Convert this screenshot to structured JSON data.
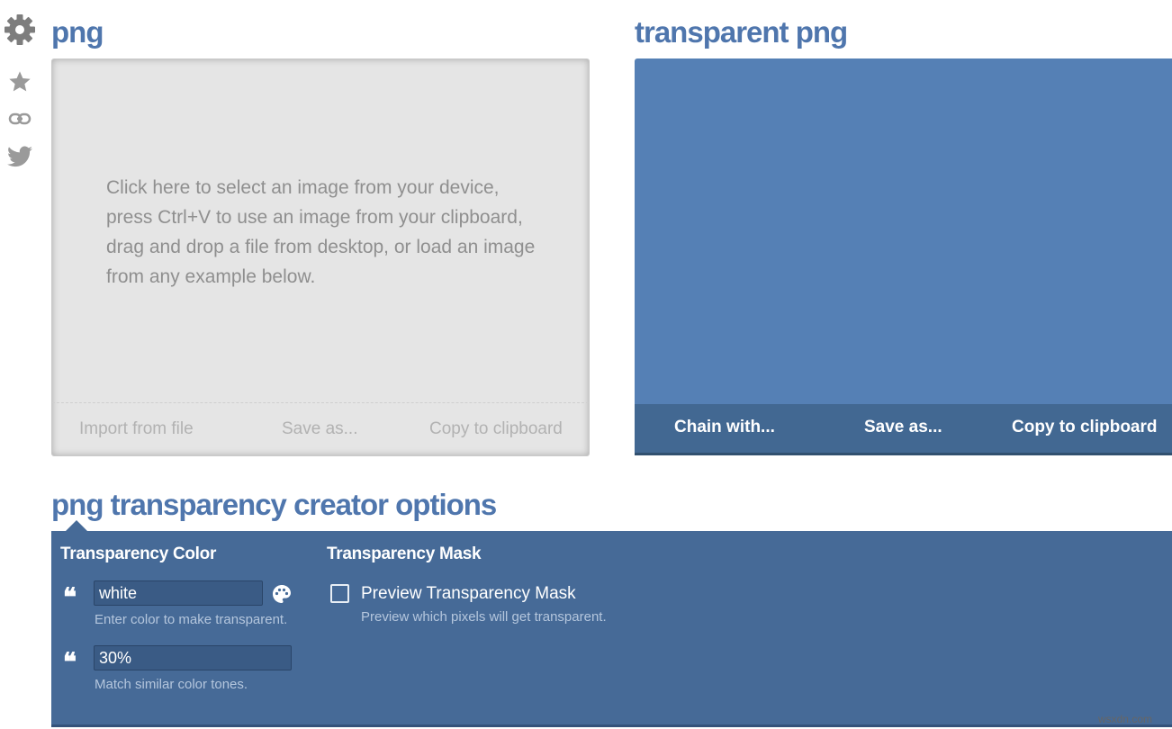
{
  "sidebar": {
    "icons": [
      "gear-icon",
      "star-icon",
      "link-icon",
      "twitter-icon"
    ]
  },
  "input": {
    "title": "png",
    "hint": "Click here to select an image from your device, press Ctrl+V to use an image from your clipboard, drag and drop a file from desktop, or load an image from any example below.",
    "actions": {
      "import": "Import from file",
      "save": "Save as...",
      "copy": "Copy to clipboard"
    }
  },
  "output": {
    "title": "transparent png",
    "actions": {
      "chain": "Chain with...",
      "save": "Save as...",
      "copy": "Copy to clipboard"
    }
  },
  "options": {
    "title": "png transparency creator options",
    "transparency_color": {
      "heading": "Transparency Color",
      "color_value": "white",
      "color_help": "Enter color to make transparent.",
      "tone_value": "30%",
      "tone_help": "Match similar color tones."
    },
    "transparency_mask": {
      "heading": "Transparency Mask",
      "checkbox_label": "Preview Transparency Mask",
      "checkbox_checked": false,
      "checkbox_help": "Preview which pixels will get transparent."
    }
  },
  "watermark": "wsxdn.com",
  "colors": {
    "accent": "#4f76ad",
    "output_bg": "#5580b5",
    "output_bar": "#426892",
    "options_bg": "#466a97"
  }
}
